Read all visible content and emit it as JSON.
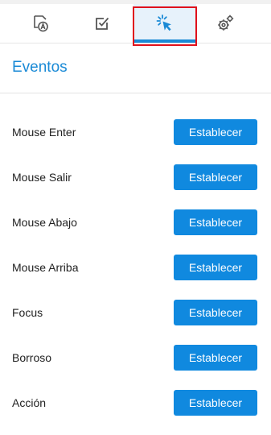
{
  "tabs": [
    {
      "icon": "style-text-icon",
      "active": false
    },
    {
      "icon": "checkbox-icon",
      "active": false
    },
    {
      "icon": "cursor-click-icon",
      "active": true
    },
    {
      "icon": "gears-icon",
      "active": false
    }
  ],
  "colors": {
    "accent": "#1a8ad6",
    "button": "#1089df",
    "active_tab_bg": "#e7f2fb",
    "focus_ring": "#e0111b"
  },
  "section": {
    "title": "Eventos"
  },
  "events": [
    {
      "label": "Mouse Enter",
      "button": "Establecer"
    },
    {
      "label": "Mouse Salir",
      "button": "Establecer"
    },
    {
      "label": "Mouse Abajo",
      "button": "Establecer"
    },
    {
      "label": "Mouse Arriba",
      "button": "Establecer"
    },
    {
      "label": "Focus",
      "button": "Establecer"
    },
    {
      "label": "Borroso",
      "button": "Establecer"
    },
    {
      "label": "Acción",
      "button": "Establecer"
    }
  ]
}
